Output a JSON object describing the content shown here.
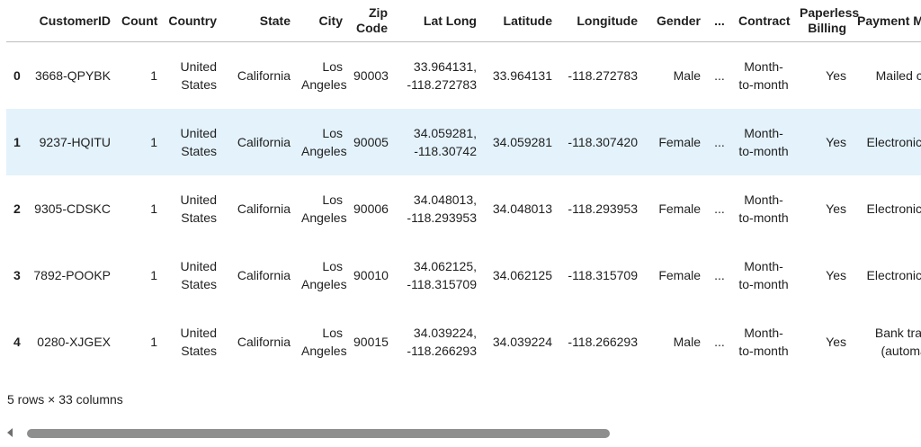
{
  "table": {
    "columns": [
      "",
      "CustomerID",
      "Count",
      "Country",
      "State",
      "City",
      "Zip Code",
      "Lat Long",
      "Latitude",
      "Longitude",
      "Gender",
      "...",
      "Contract",
      "Paperless Billing",
      "Payment Method"
    ],
    "rows": [
      {
        "index": "0",
        "customer_id": "3668-QPYBK",
        "count": "1",
        "country": "United States",
        "state": "California",
        "city": "Los Angeles",
        "zip": "90003",
        "lat_long": "33.964131, -118.272783",
        "latitude": "33.964131",
        "longitude": "-118.272783",
        "gender": "Male",
        "ellipsis": "...",
        "contract": "Month-to-month",
        "paperless": "Yes",
        "payment": "Mailed check"
      },
      {
        "index": "1",
        "customer_id": "9237-HQITU",
        "count": "1",
        "country": "United States",
        "state": "California",
        "city": "Los Angeles",
        "zip": "90005",
        "lat_long": "34.059281, -118.30742",
        "latitude": "34.059281",
        "longitude": "-118.307420",
        "gender": "Female",
        "ellipsis": "...",
        "contract": "Month-to-month",
        "paperless": "Yes",
        "payment": "Electronic check"
      },
      {
        "index": "2",
        "customer_id": "9305-CDSKC",
        "count": "1",
        "country": "United States",
        "state": "California",
        "city": "Los Angeles",
        "zip": "90006",
        "lat_long": "34.048013, -118.293953",
        "latitude": "34.048013",
        "longitude": "-118.293953",
        "gender": "Female",
        "ellipsis": "...",
        "contract": "Month-to-month",
        "paperless": "Yes",
        "payment": "Electronic check"
      },
      {
        "index": "3",
        "customer_id": "7892-POOKP",
        "count": "1",
        "country": "United States",
        "state": "California",
        "city": "Los Angeles",
        "zip": "90010",
        "lat_long": "34.062125, -118.315709",
        "latitude": "34.062125",
        "longitude": "-118.315709",
        "gender": "Female",
        "ellipsis": "...",
        "contract": "Month-to-month",
        "paperless": "Yes",
        "payment": "Electronic check"
      },
      {
        "index": "4",
        "customer_id": "0280-XJGEX",
        "count": "1",
        "country": "United States",
        "state": "California",
        "city": "Los Angeles",
        "zip": "90015",
        "lat_long": "34.039224, -118.266293",
        "latitude": "34.039224",
        "longitude": "-118.266293",
        "gender": "Male",
        "ellipsis": "...",
        "contract": "Month-to-month",
        "paperless": "Yes",
        "payment": "Bank transfer (automatic)"
      }
    ]
  },
  "footer": {
    "shape_text": "5 rows × 33 columns"
  },
  "colors": {
    "highlight_row": "#e3f2fb",
    "scroll_thumb": "#8e8e8e"
  }
}
